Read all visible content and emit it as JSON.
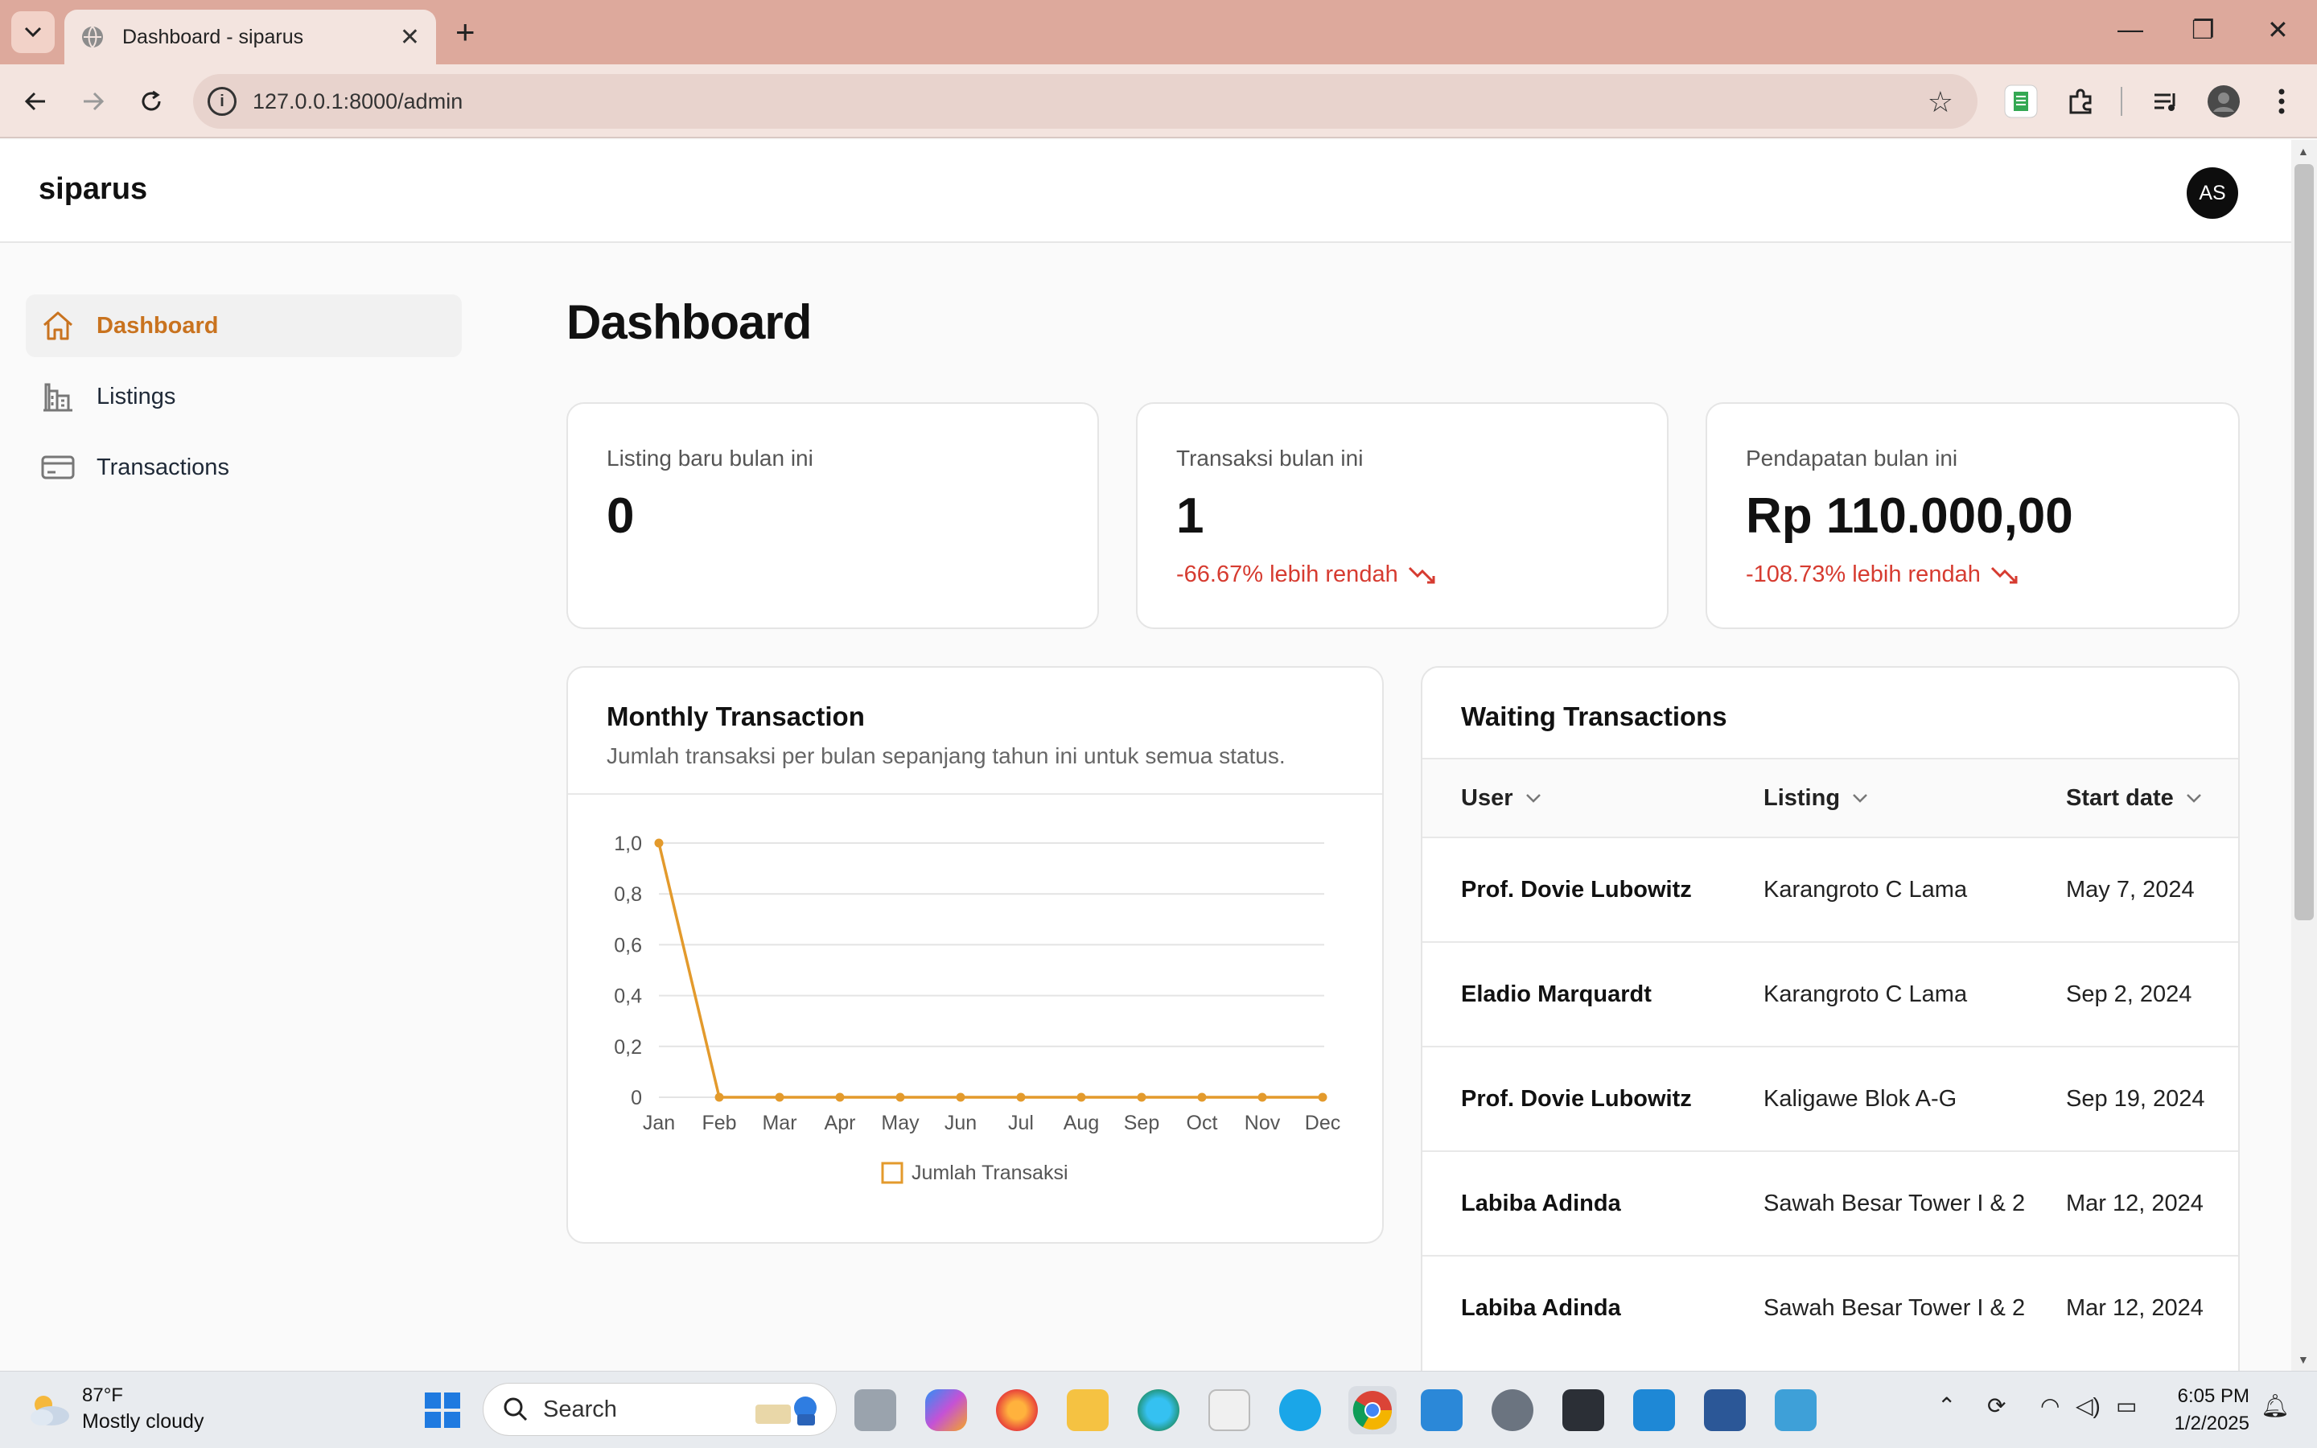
{
  "browser": {
    "tab_title": "Dashboard - siparus",
    "url": "127.0.0.1:8000/admin"
  },
  "app": {
    "brand": "siparus",
    "avatar_initials": "AS"
  },
  "sidebar": {
    "items": [
      {
        "label": "Dashboard",
        "icon": "home-icon",
        "active": true
      },
      {
        "label": "Listings",
        "icon": "buildings-icon",
        "active": false
      },
      {
        "label": "Transactions",
        "icon": "credit-card-icon",
        "active": false
      }
    ]
  },
  "page": {
    "title": "Dashboard"
  },
  "stats": [
    {
      "label": "Listing baru bulan ini",
      "value": "0",
      "delta": ""
    },
    {
      "label": "Transaksi bulan ini",
      "value": "1",
      "delta": "-66.67% lebih rendah"
    },
    {
      "label": "Pendapatan bulan ini",
      "value": "Rp 110.000,00",
      "delta": "-108.73% lebih rendah"
    }
  ],
  "monthly_chart": {
    "title": "Monthly Transaction",
    "subtitle": "Jumlah transaksi per bulan sepanjang tahun ini untuk semua status."
  },
  "chart_data": {
    "type": "line",
    "categories": [
      "Jan",
      "Feb",
      "Mar",
      "Apr",
      "May",
      "Jun",
      "Jul",
      "Aug",
      "Sep",
      "Oct",
      "Nov",
      "Dec"
    ],
    "series": [
      {
        "name": "Jumlah Transaksi",
        "values": [
          1,
          0,
          0,
          0,
          0,
          0,
          0,
          0,
          0,
          0,
          0,
          0
        ],
        "color": "#e39a2c"
      }
    ],
    "y_ticks": [
      "0",
      "0,2",
      "0,4",
      "0,6",
      "0,8",
      "1,0"
    ],
    "ylim": [
      0,
      1
    ],
    "grid": true,
    "legend": "bottom"
  },
  "waiting": {
    "title": "Waiting Transactions",
    "columns": [
      "User",
      "Listing",
      "Start date"
    ],
    "rows": [
      {
        "user": "Prof. Dovie Lubowitz",
        "listing": "Karangroto C Lama",
        "date": "May 7, 2024"
      },
      {
        "user": "Eladio Marquardt",
        "listing": "Karangroto C Lama",
        "date": "Sep 2, 2024"
      },
      {
        "user": "Prof. Dovie Lubowitz",
        "listing": "Kaligawe Blok A-G",
        "date": "Sep 19, 2024"
      },
      {
        "user": "Labiba Adinda",
        "listing": "Sawah Besar Tower I & 2",
        "date": "Mar 12, 2024"
      },
      {
        "user": "Labiba Adinda",
        "listing": "Sawah Besar Tower I & 2",
        "date": "Mar 12, 2024"
      }
    ]
  },
  "taskbar": {
    "weather_temp": "87°F",
    "weather_condition": "Mostly cloudy",
    "search_label": "Search",
    "time": "6:05 PM",
    "date": "1/2/2025"
  },
  "colors": {
    "accent": "#c9731f",
    "negative": "#d63b30",
    "chart_line": "#e39a2c",
    "tab_strip": "#dda99c"
  }
}
